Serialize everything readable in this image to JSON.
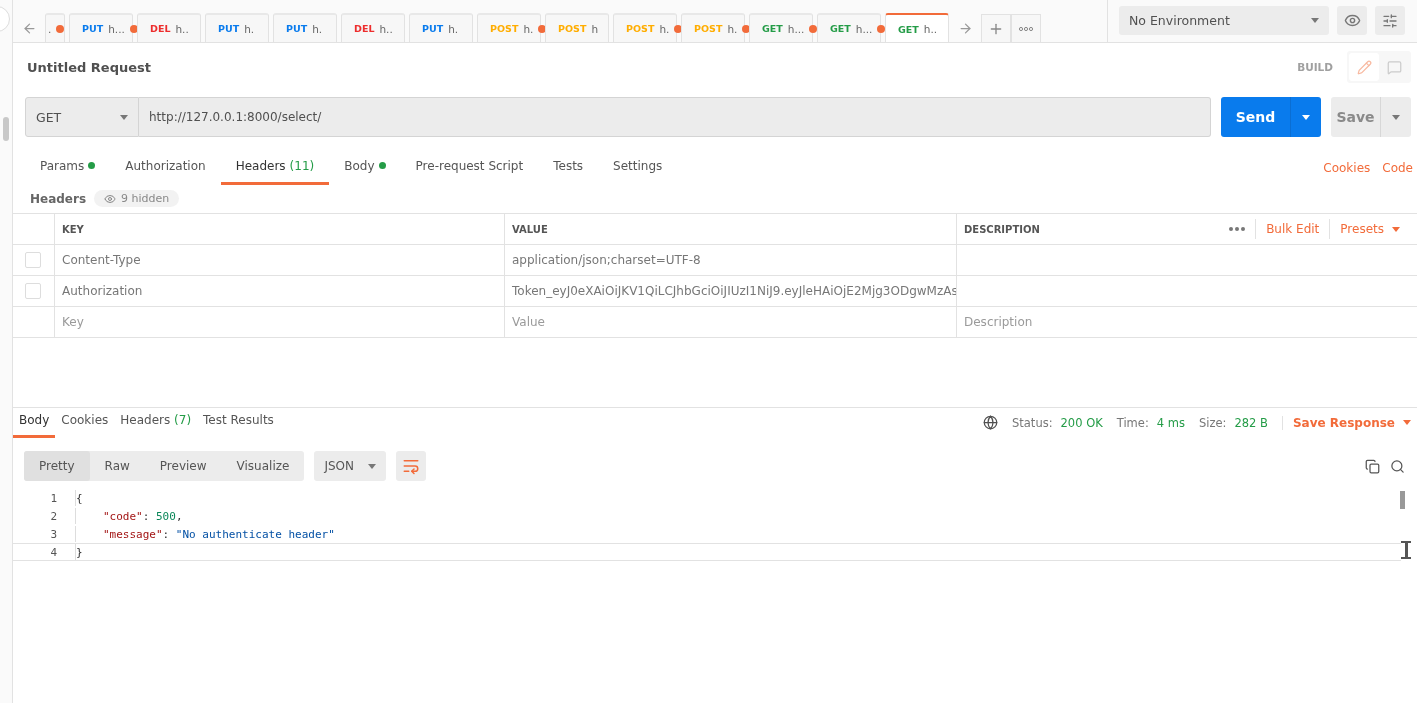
{
  "tabs": [
    {
      "name": ".",
      "unsaved": true,
      "selected": false
    },
    {
      "method": "PUT",
      "name": "h...",
      "unsaved": true,
      "selected": false
    },
    {
      "method": "DEL",
      "name": "h..",
      "unsaved": false,
      "selected": false
    },
    {
      "method": "PUT",
      "name": "h.",
      "unsaved": false,
      "selected": false
    },
    {
      "method": "PUT",
      "name": "h.",
      "unsaved": false,
      "selected": false
    },
    {
      "method": "DEL",
      "name": "h..",
      "unsaved": false,
      "selected": false
    },
    {
      "method": "PUT",
      "name": "h.",
      "unsaved": false,
      "selected": false
    },
    {
      "method": "POST",
      "name": "h.",
      "unsaved": true,
      "selected": false
    },
    {
      "method": "POST",
      "name": "h",
      "unsaved": false,
      "selected": false
    },
    {
      "method": "POST",
      "name": "h.",
      "unsaved": true,
      "selected": false
    },
    {
      "method": "POST",
      "name": "h.",
      "unsaved": true,
      "selected": false
    },
    {
      "method": "GET",
      "name": "h...",
      "unsaved": true,
      "selected": false
    },
    {
      "method": "GET",
      "name": "h...",
      "unsaved": true,
      "selected": false
    },
    {
      "method": "GET",
      "name": "h..",
      "unsaved": false,
      "selected": true
    }
  ],
  "environment": "No Environment",
  "request_title": "Untitled Request",
  "mode": "BUILD",
  "method": "GET",
  "url": "http://127.0.0.1:8000/select/",
  "send": "Send",
  "save": "Save",
  "request_tabs": [
    {
      "label": "Params",
      "dot": true,
      "selected": false
    },
    {
      "label": "Authorization",
      "dot": false,
      "selected": false
    },
    {
      "label": "Headers",
      "count": "(11)",
      "dot": false,
      "selected": true
    },
    {
      "label": "Body",
      "dot": true,
      "selected": false
    },
    {
      "label": "Pre-request Script",
      "dot": false,
      "selected": false
    },
    {
      "label": "Tests",
      "dot": false,
      "selected": false
    },
    {
      "label": "Settings",
      "dot": false,
      "selected": false
    }
  ],
  "request_links": [
    "Cookies",
    "Code"
  ],
  "headers_label": "Headers",
  "hidden_badge": "9 hidden",
  "table": {
    "columns": [
      "KEY",
      "VALUE",
      "DESCRIPTION"
    ],
    "actions": [
      "Bulk Edit",
      "Presets"
    ],
    "rows": [
      {
        "checked": false,
        "key": "Content-Type",
        "value": "application/json;charset=UTF-8"
      },
      {
        "checked": false,
        "key": "Authorization",
        "value": "Token_eyJ0eXAiOiJKV1QiLCJhbGciOiJIUzI1NiJ9.eyJleHAiOjE2Mjg3ODgwMzAs"
      }
    ],
    "new_row": {
      "key_placeholder": "Key",
      "value_placeholder": "Value",
      "description_placeholder": "Description"
    }
  },
  "response_tabs": [
    {
      "label": "Body",
      "selected": true
    },
    {
      "label": "Cookies",
      "selected": false
    },
    {
      "label": "Headers",
      "count": "(7)",
      "selected": false
    },
    {
      "label": "Test Results",
      "selected": false
    }
  ],
  "status": [
    {
      "label": "Status:",
      "value": "200 OK"
    },
    {
      "label": "Time:",
      "value": "4 ms"
    },
    {
      "label": "Size:",
      "value": "282 B"
    }
  ],
  "save_response": "Save Response",
  "view_modes": [
    {
      "label": "Pretty",
      "selected": true
    },
    {
      "label": "Raw",
      "selected": false
    },
    {
      "label": "Preview",
      "selected": false
    },
    {
      "label": "Visualize",
      "selected": false
    }
  ],
  "format": "JSON",
  "code_lines": [
    {
      "number": "1",
      "indented": false,
      "current": false,
      "tokens": [
        {
          "kind": "punct",
          "text": "{"
        }
      ]
    },
    {
      "number": "2",
      "indented": true,
      "current": false,
      "tokens": [
        {
          "kind": "key",
          "text": "\"code\""
        },
        {
          "kind": "punct",
          "text": ": "
        },
        {
          "kind": "number",
          "text": "500"
        },
        {
          "kind": "punct",
          "text": ","
        }
      ]
    },
    {
      "number": "3",
      "indented": true,
      "current": false,
      "tokens": [
        {
          "kind": "key",
          "text": "\"message\""
        },
        {
          "kind": "punct",
          "text": ": "
        },
        {
          "kind": "string",
          "text": "\"No authenticate header\""
        }
      ]
    },
    {
      "number": "4",
      "indented": false,
      "current": true,
      "tokens": [
        {
          "kind": "punct",
          "text": "}"
        }
      ]
    }
  ]
}
